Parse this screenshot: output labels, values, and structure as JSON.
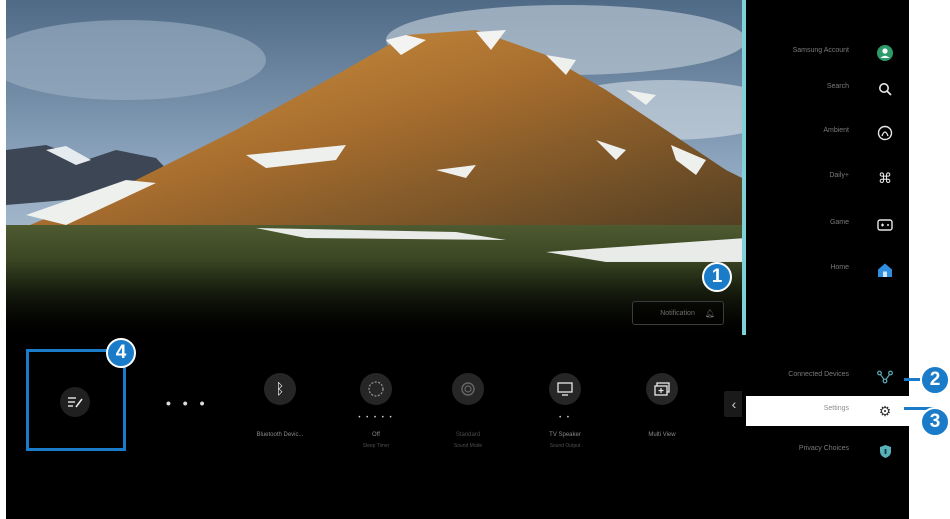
{
  "scene": {
    "notification_label": "Notification",
    "notification_icon": "bell-icon"
  },
  "quick_settings": {
    "edit_icon": "edit-list-icon",
    "more": "• • •",
    "items": [
      {
        "label": "Bluetooth Devic...",
        "sub": "",
        "icon": "bluetooth-icon",
        "dots": ""
      },
      {
        "label": "Off",
        "sub": "Sleep Timer",
        "icon": "sleep-timer-icon",
        "dots": "• • • • •"
      },
      {
        "label": "Standard",
        "sub": "Sound Mode",
        "icon": "sound-mode-icon",
        "dots": ""
      },
      {
        "label": "TV Speaker",
        "sub": "Sound Output",
        "icon": "tv-speaker-icon",
        "dots": "• •"
      },
      {
        "label": "Multi View",
        "sub": "",
        "icon": "multi-view-icon",
        "dots": ""
      }
    ],
    "scroll_left": "‹"
  },
  "menu": {
    "samsung_account": "Samsung Account",
    "search": "Search",
    "ambient": "Ambient",
    "daily": "Daily+",
    "game": "Game",
    "home": "Home",
    "connected_devices": "Connected Devices",
    "settings": "Settings",
    "privacy_choices": "Privacy Choices"
  },
  "callouts": {
    "one": "1",
    "two": "2",
    "three": "3",
    "four": "4"
  },
  "colors": {
    "accent_blue": "#1a7bc8",
    "menu_edge": "#7ed1d8",
    "background": "#000000"
  }
}
